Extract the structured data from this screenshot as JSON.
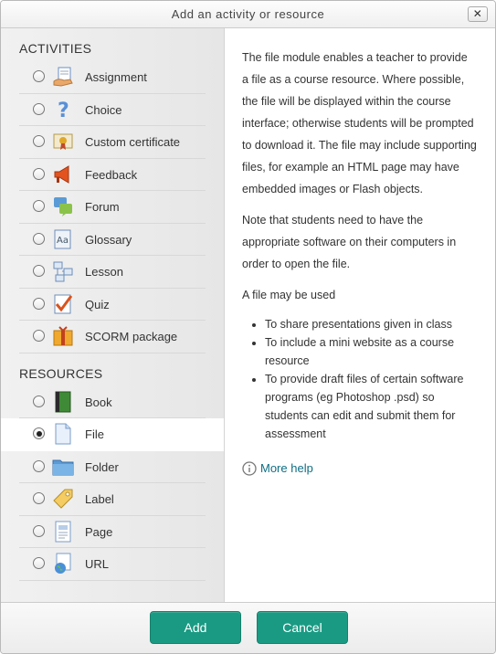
{
  "dialog": {
    "title": "Add an activity or resource",
    "close_label": "✕"
  },
  "sections": {
    "activities_title": "ACTIVITIES",
    "resources_title": "RESOURCES"
  },
  "activities": [
    {
      "label": "Assignment",
      "icon": "assignment-icon"
    },
    {
      "label": "Choice",
      "icon": "choice-icon"
    },
    {
      "label": "Custom certificate",
      "icon": "certificate-icon"
    },
    {
      "label": "Feedback",
      "icon": "feedback-icon"
    },
    {
      "label": "Forum",
      "icon": "forum-icon"
    },
    {
      "label": "Glossary",
      "icon": "glossary-icon"
    },
    {
      "label": "Lesson",
      "icon": "lesson-icon"
    },
    {
      "label": "Quiz",
      "icon": "quiz-icon"
    },
    {
      "label": "SCORM package",
      "icon": "scorm-icon"
    }
  ],
  "resources": [
    {
      "label": "Book",
      "icon": "book-icon",
      "selected": false
    },
    {
      "label": "File",
      "icon": "file-icon",
      "selected": true
    },
    {
      "label": "Folder",
      "icon": "folder-icon",
      "selected": false
    },
    {
      "label": "Label",
      "icon": "label-icon",
      "selected": false
    },
    {
      "label": "Page",
      "icon": "page-icon",
      "selected": false
    },
    {
      "label": "URL",
      "icon": "url-icon",
      "selected": false
    }
  ],
  "description": {
    "p1": "The file module enables a teacher to provide a file as a course resource. Where possible, the file will be displayed within the course interface; otherwise students will be prompted to download it. The file may include supporting files, for example an HTML page may have embedded images or Flash objects.",
    "p2": "Note that students need to have the appropriate software on their computers in order to open the file.",
    "p3": "A file may be used",
    "bullets": [
      "To share presentations given in class",
      "To include a mini website as a course resource",
      "To provide draft files of certain software programs (eg Photoshop .psd) so students can edit and submit them for assessment"
    ],
    "more_help": "More help"
  },
  "footer": {
    "add_label": "Add",
    "cancel_label": "Cancel"
  },
  "colors": {
    "button": "#1a9a83",
    "link": "#0f6e84"
  }
}
